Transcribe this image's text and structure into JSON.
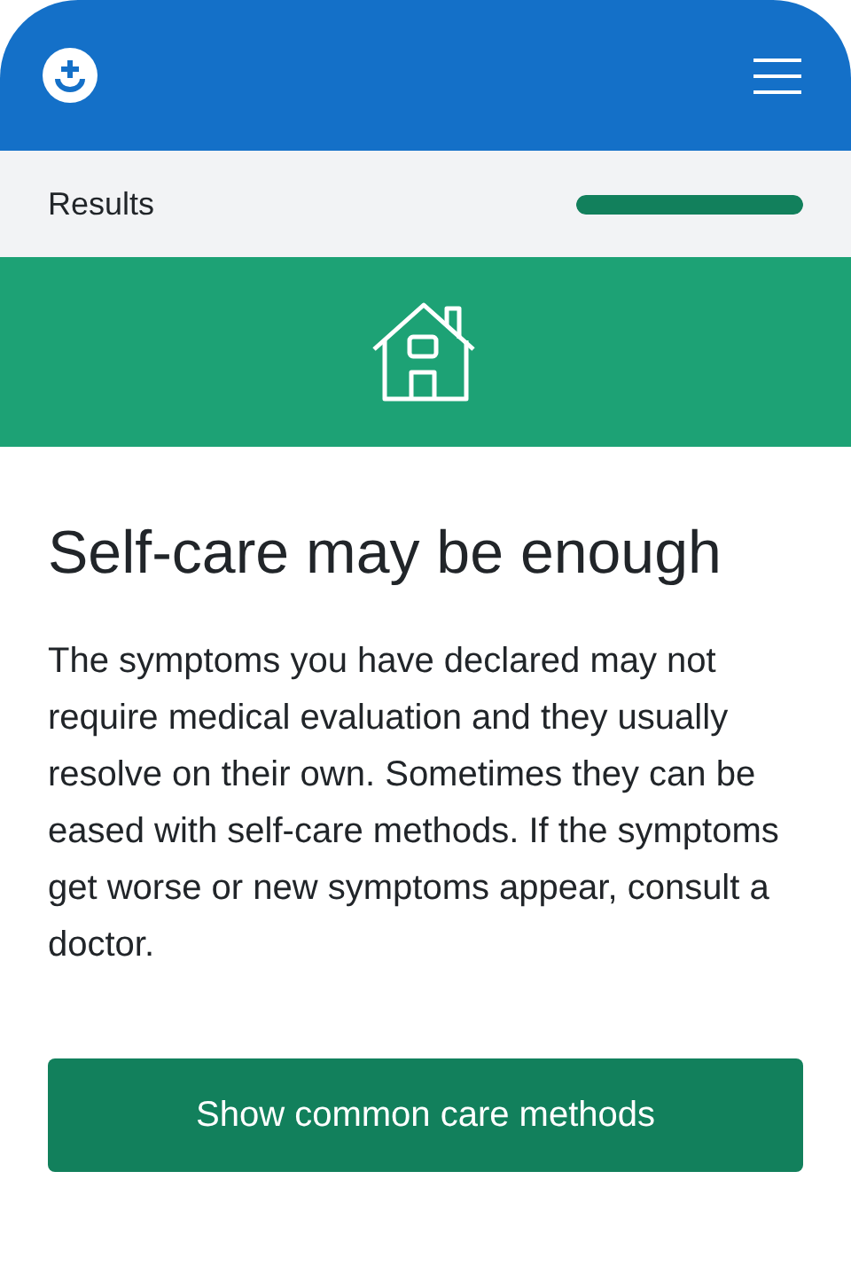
{
  "progress": {
    "label": "Results",
    "level": 1
  },
  "heading": "Self-care may be enough",
  "body": "The symptoms you have declared may not require medical evaluation and they usually resolve on their own. Sometimes they can be eased with self-care methods. If the symptoms get worse or new symptoms appear, consult a doctor.",
  "button": "Show common care methods"
}
